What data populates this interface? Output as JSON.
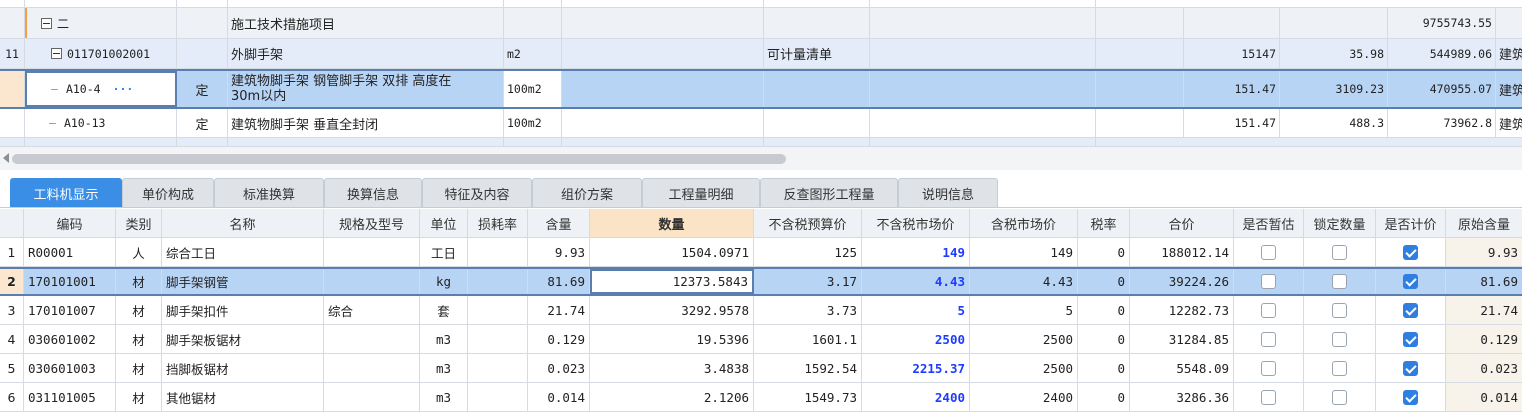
{
  "top": {
    "partial_header": "…",
    "rows": [
      {
        "index": "",
        "code": "二",
        "type": "",
        "name": "施工技术措施项目",
        "unit": "",
        "category": "",
        "quantity": "",
        "price": "",
        "total": "9755743.55",
        "spec": ""
      },
      {
        "index": "11",
        "code": "011701002001",
        "type": "",
        "name": "外脚手架",
        "unit": "m2",
        "category": "可计量清单",
        "quantity": "15147",
        "price": "35.98",
        "total": "544989.06",
        "spec": "建筑"
      },
      {
        "index": "",
        "code": "A10-4",
        "type": "定",
        "name_line1": "建筑物脚手架 钢管脚手架 双排 高度在",
        "name_line2": "30m以内",
        "unit": "100m2",
        "category": "",
        "quantity": "151.47",
        "price": "3109.23",
        "total": "470955.07",
        "spec": "建筑",
        "more": "···"
      },
      {
        "index": "",
        "code": "A10-13",
        "type": "定",
        "name": "建筑物脚手架 垂直全封闭",
        "unit": "100m2",
        "category": "",
        "quantity": "151.47",
        "price": "488.3",
        "total": "73962.8",
        "spec": "建筑"
      }
    ]
  },
  "tabs": [
    {
      "label": "工料机显示",
      "active": true
    },
    {
      "label": "单价构成"
    },
    {
      "label": "标准换算"
    },
    {
      "label": "换算信息"
    },
    {
      "label": "特征及内容"
    },
    {
      "label": "组价方案"
    },
    {
      "label": "工程量明细"
    },
    {
      "label": "反查图形工程量"
    },
    {
      "label": "说明信息"
    }
  ],
  "grid": {
    "headers": [
      "编码",
      "类别",
      "名称",
      "规格及型号",
      "单位",
      "损耗率",
      "含量",
      "数量",
      "不含税预算价",
      "不含税市场价",
      "含税市场价",
      "税率",
      "合价",
      "是否暂估",
      "锁定数量",
      "是否计价",
      "原始含量"
    ],
    "rows": [
      {
        "n": "1",
        "code": "R00001",
        "cat": "人",
        "name": "综合工日",
        "spec": "",
        "unit": "工日",
        "loss": "",
        "content": "9.93",
        "qty": "1504.0971",
        "budget": "125",
        "market": "149",
        "market_tax": "149",
        "tax": "0",
        "total": "188012.14",
        "tmp": false,
        "lock": false,
        "price": true,
        "orig": "9.93",
        "market_blue": true
      },
      {
        "n": "2",
        "code": "170101001",
        "cat": "材",
        "name": "脚手架钢管",
        "spec": "",
        "unit": "kg",
        "loss": "",
        "content": "81.69",
        "qty": "12373.5843",
        "budget": "3.17",
        "market": "4.43",
        "market_tax": "4.43",
        "tax": "0",
        "total": "39224.26",
        "tmp": false,
        "lock": false,
        "price": true,
        "orig": "81.69",
        "market_blue": true,
        "selected": true
      },
      {
        "n": "3",
        "code": "170101007",
        "cat": "材",
        "name": "脚手架扣件",
        "spec": "综合",
        "unit": "套",
        "loss": "",
        "content": "21.74",
        "qty": "3292.9578",
        "budget": "3.73",
        "market": "5",
        "market_tax": "5",
        "tax": "0",
        "total": "12282.73",
        "tmp": false,
        "lock": false,
        "price": true,
        "orig": "21.74",
        "market_blue": true
      },
      {
        "n": "4",
        "code": "030601002",
        "cat": "材",
        "name": "脚手架板锯材",
        "spec": "",
        "unit": "m3",
        "loss": "",
        "content": "0.129",
        "qty": "19.5396",
        "budget": "1601.1",
        "market": "2500",
        "market_tax": "2500",
        "tax": "0",
        "total": "31284.85",
        "tmp": false,
        "lock": false,
        "price": true,
        "orig": "0.129",
        "market_blue": true
      },
      {
        "n": "5",
        "code": "030601003",
        "cat": "材",
        "name": "挡脚板锯材",
        "spec": "",
        "unit": "m3",
        "loss": "",
        "content": "0.023",
        "qty": "3.4838",
        "budget": "1592.54",
        "market": "2215.37",
        "market_tax": "2500",
        "tax": "0",
        "total": "5548.09",
        "tmp": false,
        "lock": false,
        "price": true,
        "orig": "0.023",
        "market_blue": true
      },
      {
        "n": "6",
        "code": "031101005",
        "cat": "材",
        "name": "其他锯材",
        "spec": "",
        "unit": "m3",
        "loss": "",
        "content": "0.014",
        "qty": "2.1206",
        "budget": "1549.73",
        "market": "2400",
        "market_tax": "2400",
        "tax": "0",
        "total": "3286.36",
        "tmp": false,
        "lock": false,
        "price": true,
        "orig": "0.014",
        "market_blue": true
      }
    ]
  }
}
